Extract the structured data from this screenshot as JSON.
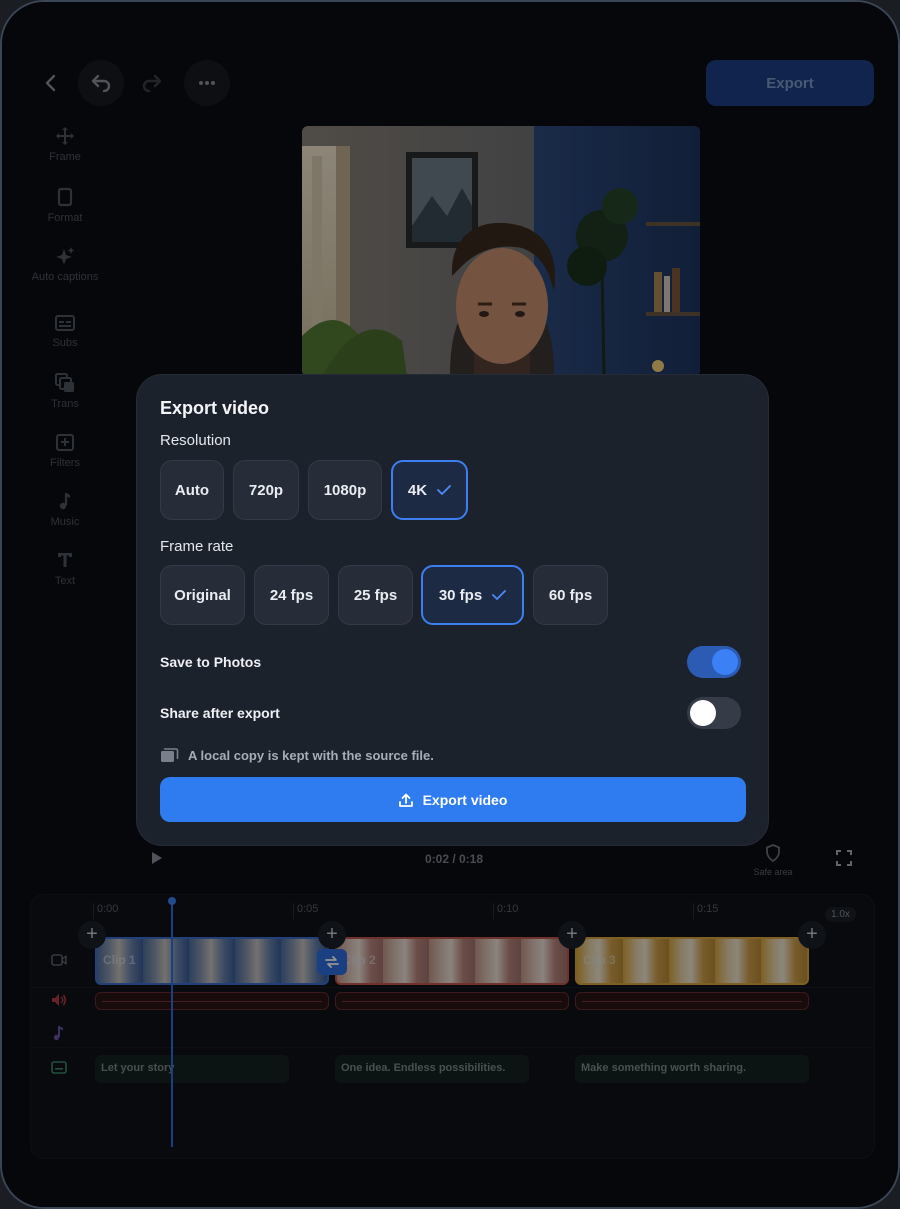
{
  "topbar": {
    "export_label": "Export"
  },
  "tools": [
    {
      "label": "Frame",
      "icon": "frame-move-icon"
    },
    {
      "label": "Format",
      "icon": "format-icon"
    },
    {
      "label": "Auto captions",
      "icon": "sparkle-icon"
    },
    {
      "label": "Subs",
      "icon": "subtitles-icon"
    },
    {
      "label": "Trans",
      "icon": "transitions-icon"
    },
    {
      "label": "Filters",
      "icon": "filters-icon"
    },
    {
      "label": "Music",
      "icon": "music-note-icon"
    },
    {
      "label": "Text",
      "icon": "text-icon"
    }
  ],
  "player": {
    "time": "0:02 / 0:18",
    "safe_area_label": "Safe area"
  },
  "timeline": {
    "ruler": [
      "0:00",
      "0:05",
      "0:10",
      "0:15"
    ],
    "zoom": "1.0x",
    "clips": [
      "Clip 1",
      "Clip 2",
      "Clip 3"
    ],
    "captions": [
      "Let your story",
      "One idea. Endless possibilities.",
      "Make something worth sharing."
    ]
  },
  "modal": {
    "title": "Export video",
    "resolution_label": "Resolution",
    "resolutions": [
      "Auto",
      "720p",
      "1080p",
      "4K"
    ],
    "selected_resolution": "4K",
    "frame_rate_label": "Frame rate",
    "frame_rates": [
      "Original",
      "24 fps",
      "25 fps",
      "30 fps",
      "60 fps"
    ],
    "selected_frame_rate": "30 fps",
    "save_to_photos_label": "Save to Photos",
    "save_to_photos": true,
    "share_after_export_label": "Share after export",
    "share_after_export": false,
    "note": "A local copy is kept with the source file.",
    "export_button": "Export video"
  },
  "colors": {
    "accent": "#2f7cf0",
    "clip1": "#3a5b96",
    "clip2": "#b9857d",
    "clip3": "#d9a640"
  }
}
